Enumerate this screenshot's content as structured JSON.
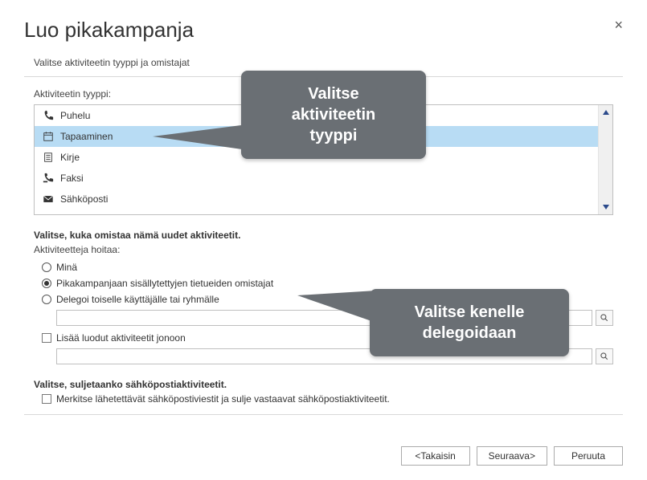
{
  "dialog": {
    "title": "Luo pikakampanja",
    "subtitle": "Valitse aktiviteetin tyyppi ja omistajat"
  },
  "activity_type": {
    "label": "Aktiviteetin tyyppi:",
    "items": [
      {
        "icon": "phone",
        "label": "Puhelu"
      },
      {
        "icon": "calendar",
        "label": "Tapaaminen"
      },
      {
        "icon": "doc",
        "label": "Kirje"
      },
      {
        "icon": "fax",
        "label": "Faksi"
      },
      {
        "icon": "mail",
        "label": "Sähköposti"
      }
    ],
    "selected_index": 1
  },
  "owner": {
    "heading": "Valitse, kuka omistaa nämä uudet aktiviteetit.",
    "sub": "Aktiviteetteja hoitaa:",
    "options": [
      "Minä",
      "Pikakampanjaan sisällytettyjen tietueiden omistajat",
      "Delegoi toiselle käyttäjälle tai ryhmälle"
    ],
    "selected_index": 1,
    "queue_checkbox": "Lisää luodut aktiviteetit jonoon"
  },
  "email": {
    "heading": "Valitse, suljetaanko sähköpostiaktiviteetit.",
    "checkbox": "Merkitse lähetettävät sähköpostiviestit ja sulje vastaavat sähköpostiaktiviteetit."
  },
  "buttons": {
    "back": "<Takaisin",
    "next": "Seuraava>",
    "cancel": "Peruuta"
  },
  "callouts": {
    "top": "Valitse\naktiviteetin\ntyyppi",
    "bottom": "Valitse kenelle\ndelegoidaan"
  }
}
